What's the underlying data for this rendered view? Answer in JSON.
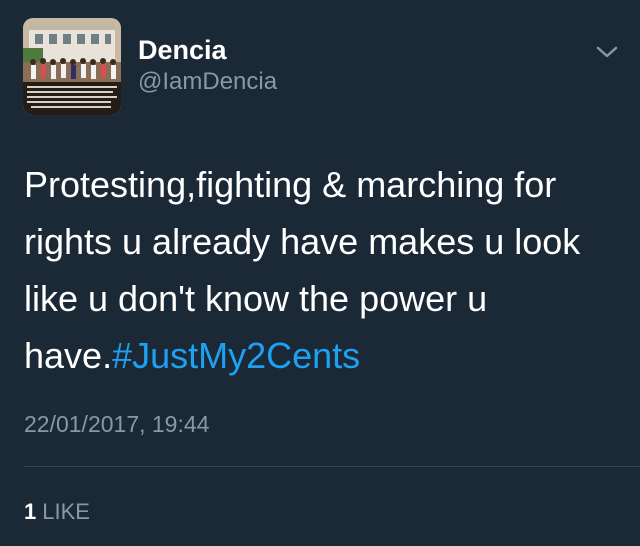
{
  "author": {
    "display_name": "Dencia",
    "handle": "@IamDencia"
  },
  "tweet": {
    "text": "Protesting,fighting & marching for rights u already have makes u look like u don't know the power u have.",
    "hashtag": "#JustMy2Cents",
    "timestamp": "22/01/2017, 19:44"
  },
  "engagement": {
    "like_count": "1",
    "like_label": "LIKE"
  },
  "icons": {
    "menu": "chevron-down-icon"
  },
  "colors": {
    "background": "#1b2836",
    "text_primary": "#ffffff",
    "text_secondary": "#8899a6",
    "accent": "#1da1f2",
    "divider": "#38444d"
  }
}
